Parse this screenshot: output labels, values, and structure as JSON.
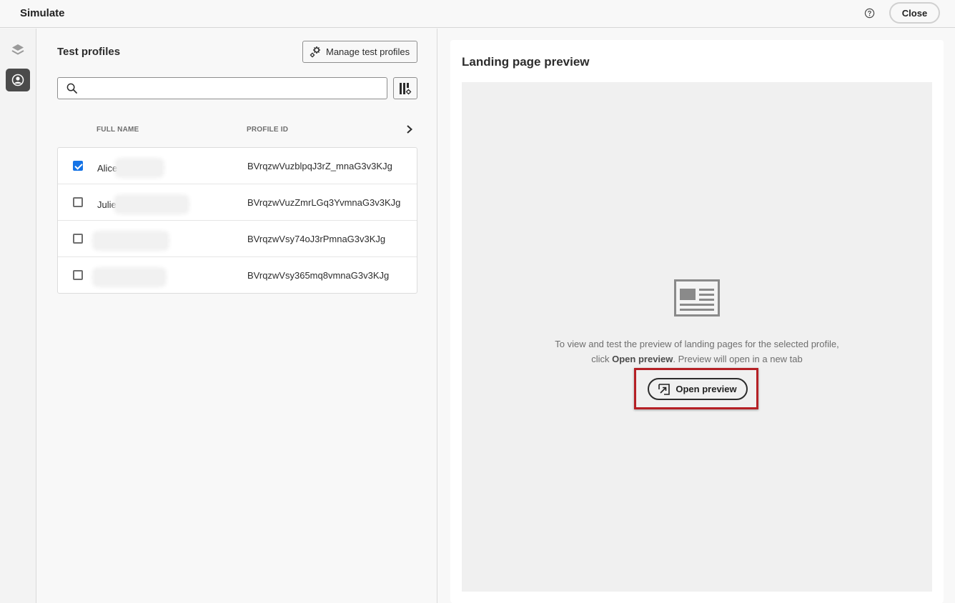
{
  "app": {
    "title": "Simulate",
    "close_label": "Close"
  },
  "rail": {
    "items": [
      {
        "icon": "layers-icon",
        "active": false
      },
      {
        "icon": "profile-icon",
        "active": true
      }
    ]
  },
  "test_profiles": {
    "title": "Test profiles",
    "manage_label": "Manage test profiles",
    "search": {
      "placeholder": "",
      "value": ""
    },
    "columns": [
      "FULL NAME",
      "PROFILE ID"
    ],
    "rows": [
      {
        "name": "Alice",
        "profile_id": "BVrqzwVuzblpqJ3rZ_mnaG3v3KJg",
        "checked": true
      },
      {
        "name": "Julie",
        "profile_id": "BVrqzwVuzZmrLGq3YvmnaG3v3KJg",
        "checked": false
      },
      {
        "name": "",
        "profile_id": "BVrqzwVsy74oJ3rPmnaG3v3KJg",
        "checked": false
      },
      {
        "name": "",
        "profile_id": "BVrqzwVsy365mq8vmnaG3v3KJg",
        "checked": false
      }
    ]
  },
  "preview": {
    "title": "Landing page preview",
    "text_before": "To view and test the preview of landing pages for the selected profile, click ",
    "text_bold": "Open preview",
    "text_after": ". Preview will open in a new tab",
    "button_label": "Open preview"
  },
  "colors": {
    "accent": "#1473e6",
    "highlight": "#b52025"
  }
}
